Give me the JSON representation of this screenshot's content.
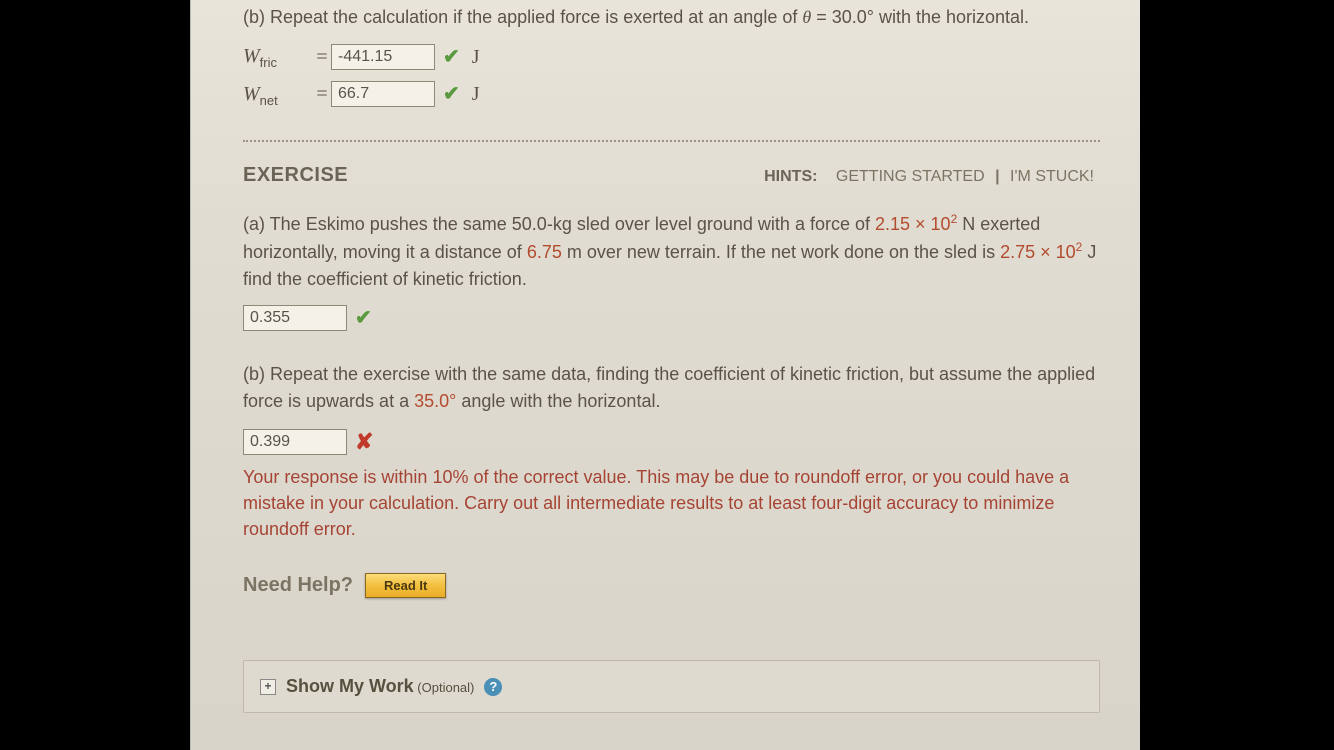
{
  "partB1": {
    "text_prefix": "(b) Repeat the calculation if the applied force is exerted at an angle of ",
    "theta": "θ",
    "eq": " = 30.0° with the horizontal.",
    "wfric_label_var": "W",
    "wfric_label_sub": "fric",
    "wfric_value": "-441.15",
    "wnet_label_var": "W",
    "wnet_label_sub": "net",
    "wnet_value": "66.7",
    "unit": "J"
  },
  "exercise": {
    "title": "EXERCISE",
    "hints_label": "HINTS:",
    "hint1": "GETTING STARTED",
    "hint2": "I'M STUCK!"
  },
  "partA": {
    "text1": "(a) The Eskimo pushes the same 50.0-kg sled over level ground with a force of ",
    "val1": "2.15 × 10",
    "val1_sup": "2",
    "text2": " N exerted horizontally, moving it a distance of ",
    "val2": "6.75",
    "text3": " m over new terrain. If the net work done on the sled is ",
    "val3": "2.75 × 10",
    "val3_sup": "2",
    "text4": " J find the coefficient of kinetic friction.",
    "input_value": "0.355"
  },
  "partB2": {
    "text1": "(b) Repeat the exercise with the same data, finding the coefficient of kinetic friction, but assume the applied force is upwards at a ",
    "angle": "35.0°",
    "text2": " angle with the horizontal.",
    "input_value": "0.399",
    "feedback": "Your response is within 10% of the correct value. This may be due to roundoff error, or you could have a mistake in your calculation. Carry out all intermediate results to at least four-digit accuracy to minimize roundoff error."
  },
  "help": {
    "label": "Need Help?",
    "read_it": "Read It"
  },
  "showWork": {
    "text": "Show My Work",
    "optional": " (Optional)"
  }
}
